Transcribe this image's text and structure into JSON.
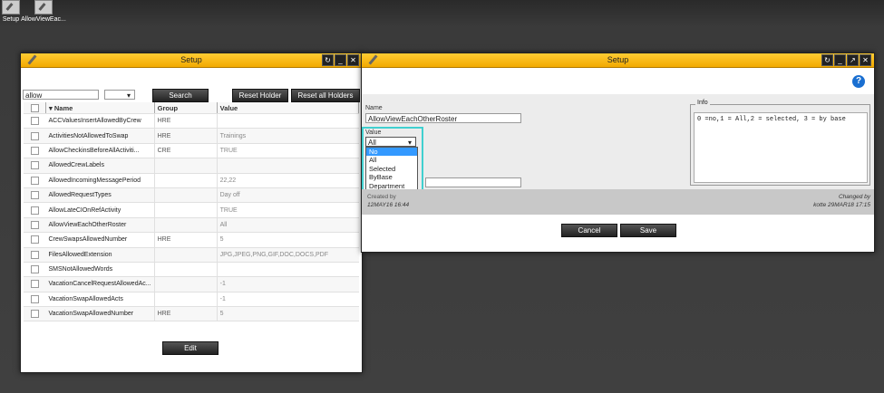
{
  "desktop": {
    "icons": [
      {
        "label": "Setup"
      },
      {
        "label": "AllowViewEac..."
      }
    ]
  },
  "left_window": {
    "title": "Setup",
    "search_value": "allow",
    "filter_value": "",
    "search_label": "Search",
    "reset_holder_label": "Reset Holder",
    "reset_all_label": "Reset all Holders",
    "columns": {
      "name": "Name",
      "group": "Group",
      "value": "Value"
    },
    "rows": [
      {
        "name": "ACCValuesInsertAllowedByCrew",
        "group": "HRE",
        "value": ""
      },
      {
        "name": "ActivitiesNotAllowedToSwap",
        "group": "HRE",
        "value": "Trainings"
      },
      {
        "name": "AllowCheckinsBeforeAllActiviti...",
        "group": "CRE",
        "value": "TRUE"
      },
      {
        "name": "AllowedCrewLabels",
        "group": "",
        "value": ""
      },
      {
        "name": "AllowedIncomingMessagePeriod",
        "group": "",
        "value": "22,22"
      },
      {
        "name": "AllowedRequestTypes",
        "group": "",
        "value": "Day off"
      },
      {
        "name": "AllowLateCIOnRefActivity",
        "group": "",
        "value": "TRUE"
      },
      {
        "name": "AllowViewEachOtherRoster",
        "group": "",
        "value": "All"
      },
      {
        "name": "CrewSwapsAllowedNumber",
        "group": "HRE",
        "value": "5"
      },
      {
        "name": "FilesAllowedExtension",
        "group": "",
        "value": "JPG,JPEG,PNG,GIF,DOC,DOCS,PDF"
      },
      {
        "name": "SMSNotAllowedWords",
        "group": "",
        "value": ""
      },
      {
        "name": "VacationCancelRequestAllowedAc...",
        "group": "",
        "value": "-1"
      },
      {
        "name": "VacationSwapAllowedActs",
        "group": "",
        "value": "-1"
      },
      {
        "name": "VacationSwapAllowedNumber",
        "group": "HRE",
        "value": "5"
      }
    ],
    "edit_label": "Edit"
  },
  "right_window": {
    "title": "Setup",
    "name_label": "Name",
    "name_value": "AllowViewEachOtherRoster",
    "value_label": "Value",
    "value_selected": "All",
    "options": [
      "No",
      "All",
      "Selected",
      "ByBase",
      "Department"
    ],
    "highlighted_option": "No",
    "info_label": "Info",
    "info_text": "0 =no,1 = All,2 = selected, 3 = by base",
    "created_by_label": "Created by",
    "created_by_value": "12MAY16 16:44",
    "changed_by_label": "Changed by",
    "changed_by_value": "kotte 29MAR18 17:15",
    "cancel_label": "Cancel",
    "save_label": "Save"
  },
  "colors": {
    "titlebar": "#f2a900",
    "highlight": "#40d0d0",
    "selection": "#3399ff",
    "help": "#1a6fd1"
  }
}
